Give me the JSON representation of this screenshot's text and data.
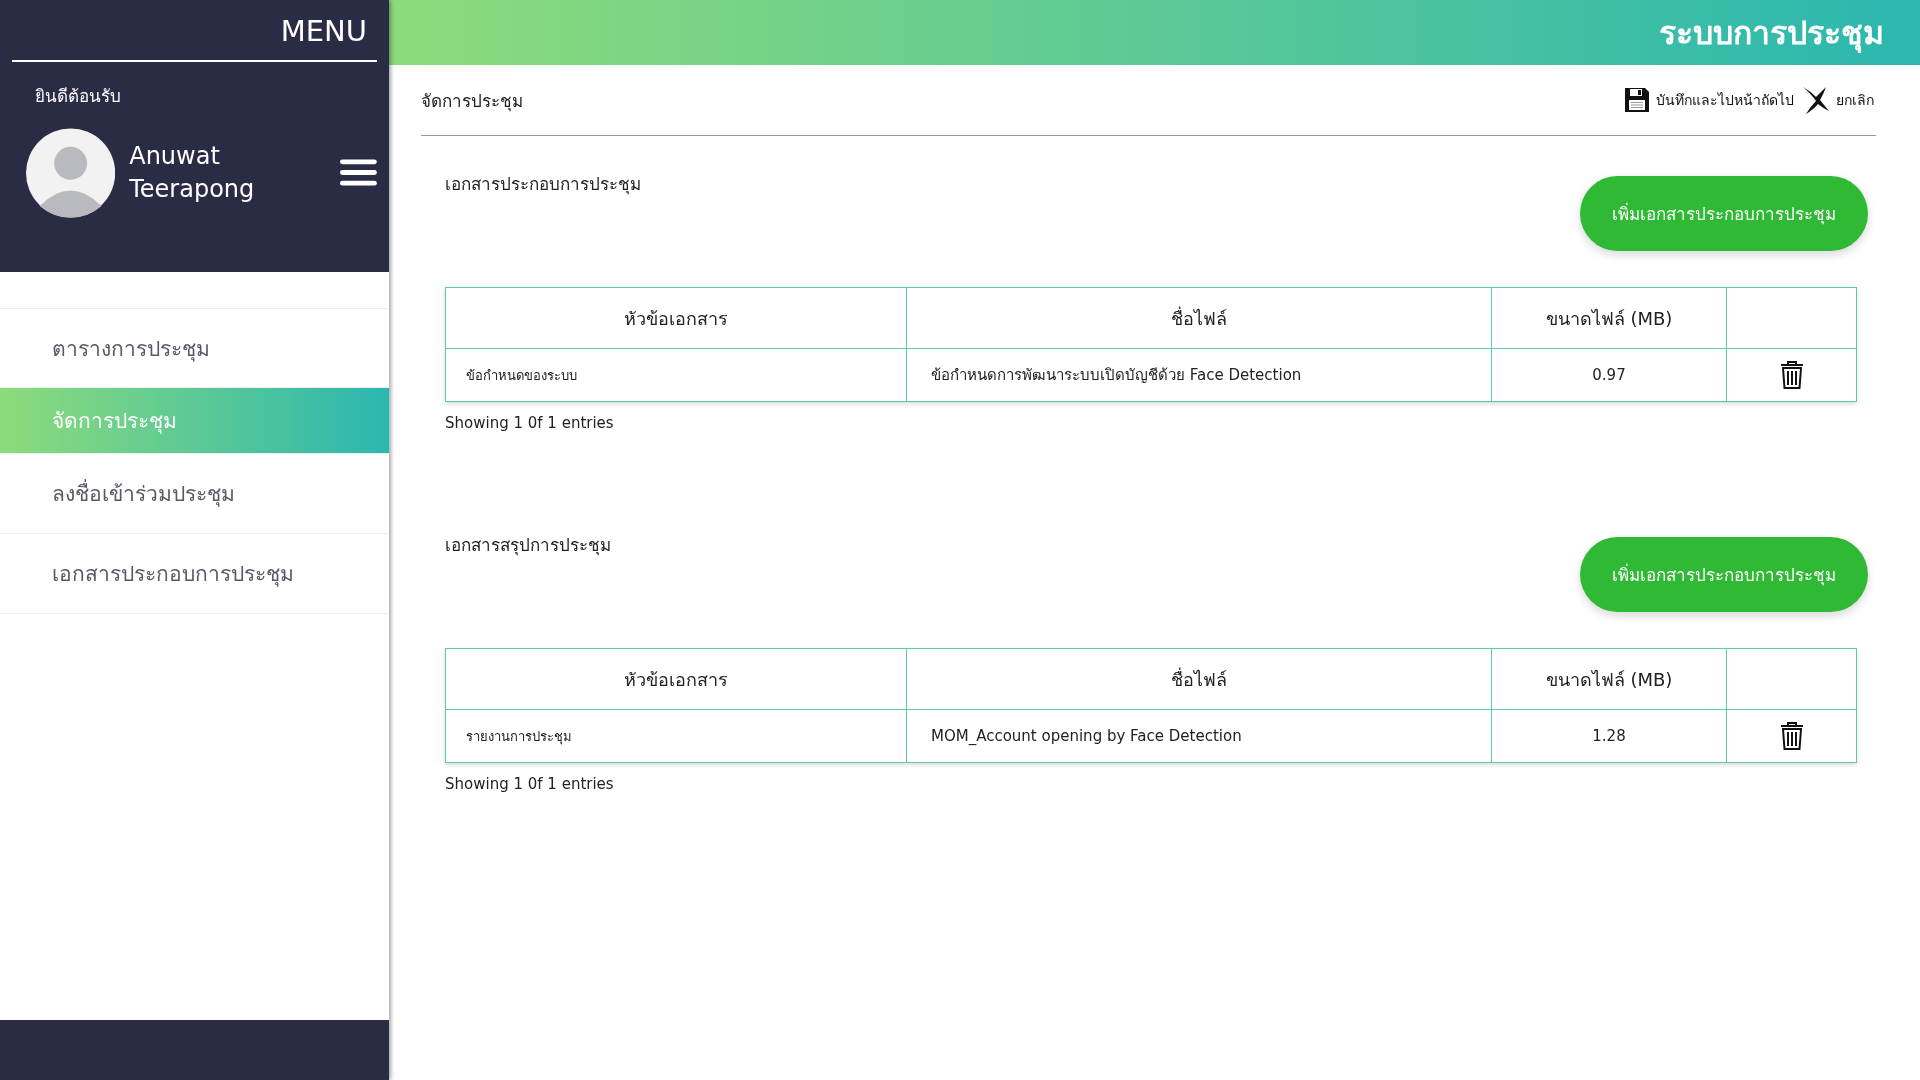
{
  "sidebar": {
    "menu_title": "MENU",
    "welcome": "ยินดีต้อนรับ",
    "user_name": "Anuwat Teerapong",
    "items": [
      {
        "label": "ตารางการประชุม",
        "selected": false
      },
      {
        "label": "จัดการประชุม",
        "selected": true
      },
      {
        "label": "ลงชื่อเข้าร่วมประชุม",
        "selected": false
      },
      {
        "label": "เอกสารประกอบการประชุม",
        "selected": false
      }
    ]
  },
  "header": {
    "title": "ระบบการประชุม"
  },
  "toolbar": {
    "breadcrumb": "จัดการประชุม",
    "save_label": "บันทึกและไปหน้าถัดไป",
    "cancel_label": "ยกเลิก"
  },
  "sections": [
    {
      "title": "เอกสารประกอบการประชุม",
      "add_button": "เพิ่มเอกสารประกอบการประชุม",
      "columns": [
        "หัวข้อเอกสาร",
        "ชื่อไฟล์",
        "ขนาดไฟล์ (MB)"
      ],
      "rows": [
        {
          "topic": "ข้อกำหนดของระบบ",
          "file": "ข้อกำหนดการพัฒนาระบบเปิดบัญชีด้วย Face Detection",
          "size": "0.97"
        }
      ],
      "footer": "Showing 1 0f 1 entries"
    },
    {
      "title": "เอกสารสรุปการประชุม",
      "add_button": "เพิ่มเอกสารประกอบการประชุม",
      "columns": [
        "หัวข้อเอกสาร",
        "ชื่อไฟล์",
        "ขนาดไฟล์ (MB)"
      ],
      "rows": [
        {
          "topic": "รายงานการประชุม",
          "file": "MOM_Account opening by Face Detection",
          "size": "1.28"
        }
      ],
      "footer": "Showing 1 0f 1 entries"
    }
  ]
}
